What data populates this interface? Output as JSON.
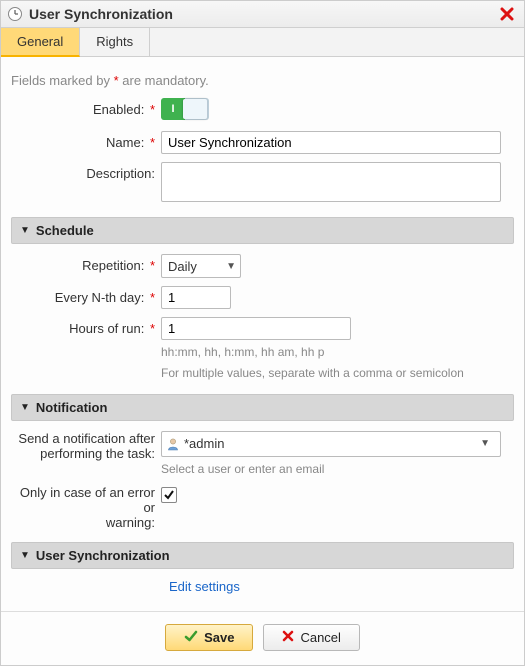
{
  "title": "User Synchronization",
  "tabs": {
    "general": "General",
    "rights": "Rights"
  },
  "mandatory_hint_pre": "Fields marked by ",
  "mandatory_hint_post": " are mandatory.",
  "asterisk": "*",
  "labels": {
    "enabled": "Enabled:",
    "name": "Name:",
    "description": "Description:",
    "repetition": "Repetition:",
    "every_nth": "Every N-th day:",
    "hours": "Hours of run:",
    "send_notif_1": "Send a notification after",
    "send_notif_2": "performing the task:",
    "only_error_1": "Only in case of an error or",
    "only_error_2": "warning:"
  },
  "values": {
    "name": "User Synchronization",
    "description": "",
    "repetition": "Daily",
    "every_nth": "1",
    "hours": "1",
    "notif_user": "*admin",
    "only_error_checked": true
  },
  "hints": {
    "hours1": "hh:mm, hh, h:mm, hh am, hh p",
    "hours2": "For multiple values, separate with a comma or semicolon",
    "notif_placeholder": "Select a user or enter an email"
  },
  "sections": {
    "schedule": "Schedule",
    "notification": "Notification",
    "usersync": "User Synchronization"
  },
  "links": {
    "edit_settings": "Edit settings"
  },
  "buttons": {
    "save": "Save",
    "cancel": "Cancel"
  },
  "toggle_on_label": "I"
}
